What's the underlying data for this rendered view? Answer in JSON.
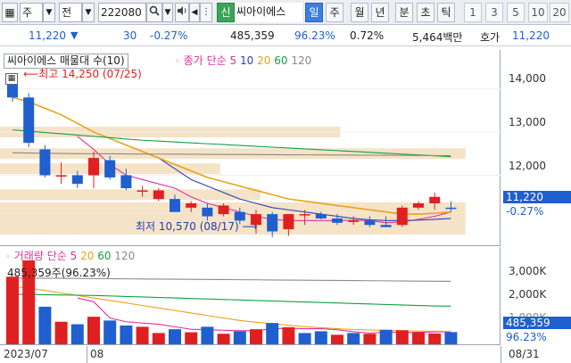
{
  "toolbar": {
    "type_value": "주",
    "range_value": "전",
    "code_value": "222080",
    "badge_label": "신",
    "stock_name": "씨아이에스",
    "period_tabs": [
      "일",
      "주",
      "월",
      "년",
      "분",
      "초",
      "틱"
    ],
    "active_tab_index": 0,
    "minute_options": [
      "1",
      "3",
      "5",
      "10",
      "20"
    ]
  },
  "quote": {
    "price": "11,220",
    "change": "30",
    "change_pct": "-0.27%",
    "volume": "485,359",
    "volume_ratio": "96.23%",
    "turnover": "0.72%",
    "amount": "5,464백만",
    "bid_label": "호가",
    "bid_price": "11,220"
  },
  "price_chart": {
    "legend_name": "씨아이에스 매물대 수(10)",
    "legend_ma_label": "종가 단순",
    "ma_periods": [
      "5",
      "10",
      "20",
      "60",
      "120"
    ],
    "ma_colors": [
      "#e0329a",
      "#2b3fb6",
      "#e8a21a",
      "#13a043",
      "#8a8a8a"
    ],
    "high_annotation": "최고 14,250 (07/25)",
    "low_annotation": "최저 10,570 (08/17)",
    "axis_labels": [
      "14,000",
      "13,000",
      "12,000"
    ],
    "current_price_tag": "11,220",
    "current_change_tag": "-0.27%"
  },
  "volume_chart": {
    "legend_name": "거래량",
    "legend_ma_label": "단순",
    "ma_periods": [
      "5",
      "20",
      "60",
      "120"
    ],
    "ma_colors": [
      "#e0329a",
      "#e8a21a",
      "#13a043",
      "#8a8a8a"
    ],
    "max_annotation": "485,359주(96.23%)",
    "axis_labels": [
      "3,000K",
      "2,000K",
      "1,000K"
    ],
    "current_volume_tag": "485,359",
    "current_ratio_tag": "96.23%"
  },
  "dates": {
    "start": "2023/07",
    "month_mark": "08",
    "end": "08/31"
  },
  "colors": {
    "up": "#e02020",
    "down": "#1f5fd0",
    "accent": "#3b7fe0",
    "volume_profile": "#f5e3c8"
  },
  "chart_data": [
    {
      "type": "candlestick",
      "title": "씨아이에스 매물대 수(10)",
      "ylim": [
        10400,
        14900
      ],
      "candles": [
        {
          "o": 14200,
          "h": 14250,
          "l": 13700,
          "c": 13800
        },
        {
          "o": 13800,
          "h": 13900,
          "l": 12650,
          "c": 12750
        },
        {
          "o": 12600,
          "h": 12700,
          "l": 11950,
          "c": 12000
        },
        {
          "o": 12000,
          "h": 12300,
          "l": 11800,
          "c": 12000
        },
        {
          "o": 12000,
          "h": 12100,
          "l": 11700,
          "c": 11800
        },
        {
          "o": 12000,
          "h": 12550,
          "l": 11700,
          "c": 12400
        },
        {
          "o": 12350,
          "h": 12450,
          "l": 11900,
          "c": 11950
        },
        {
          "o": 12000,
          "h": 12150,
          "l": 11650,
          "c": 11700
        },
        {
          "o": 11650,
          "h": 11750,
          "l": 11500,
          "c": 11650
        },
        {
          "o": 11450,
          "h": 11700,
          "l": 11400,
          "c": 11650
        },
        {
          "o": 11450,
          "h": 11550,
          "l": 11150,
          "c": 11150
        },
        {
          "o": 11250,
          "h": 11400,
          "l": 11150,
          "c": 11350
        },
        {
          "o": 11250,
          "h": 11350,
          "l": 10950,
          "c": 11050
        },
        {
          "o": 11100,
          "h": 11350,
          "l": 11050,
          "c": 11300
        },
        {
          "o": 11150,
          "h": 11250,
          "l": 10870,
          "c": 10950
        },
        {
          "o": 10850,
          "h": 11200,
          "l": 10650,
          "c": 11100
        },
        {
          "o": 11100,
          "h": 11150,
          "l": 10570,
          "c": 10700
        },
        {
          "o": 10750,
          "h": 11100,
          "l": 10600,
          "c": 11100
        },
        {
          "o": 11100,
          "h": 11200,
          "l": 10850,
          "c": 11100
        },
        {
          "o": 11100,
          "h": 11150,
          "l": 10980,
          "c": 11000
        },
        {
          "o": 11000,
          "h": 11100,
          "l": 10850,
          "c": 10900
        },
        {
          "o": 10950,
          "h": 11050,
          "l": 10850,
          "c": 10950
        },
        {
          "o": 10950,
          "h": 11050,
          "l": 10800,
          "c": 10850
        },
        {
          "o": 10850,
          "h": 11050,
          "l": 10800,
          "c": 10800
        },
        {
          "o": 10850,
          "h": 11300,
          "l": 10800,
          "c": 11250
        },
        {
          "o": 11250,
          "h": 11400,
          "l": 11200,
          "c": 11350
        },
        {
          "o": 11350,
          "h": 11600,
          "l": 11200,
          "c": 11500
        },
        {
          "o": 11250,
          "h": 11400,
          "l": 11150,
          "c": 11220
        }
      ],
      "ma": [
        {
          "period": "5",
          "values": [
            null,
            null,
            null,
            null,
            12900,
            12600,
            12250,
            12000,
            11900,
            11800,
            11700,
            11500,
            11350,
            11250,
            11150,
            11050,
            10980,
            10950,
            10950,
            10950,
            10950,
            10960,
            10950,
            10900,
            10920,
            10980,
            11050,
            11150
          ]
        },
        {
          "period": "10",
          "values": [
            null,
            null,
            null,
            null,
            null,
            null,
            null,
            null,
            null,
            12400,
            12150,
            11900,
            11750,
            11600,
            11450,
            11350,
            11250,
            11200,
            11150,
            11100,
            11050,
            11000,
            10970,
            10950,
            10950,
            10960,
            10980,
            11000
          ]
        },
        {
          "period": "20",
          "values": [
            13800,
            13700,
            13550,
            13400,
            13200,
            13000,
            12850,
            12700,
            12550,
            12400,
            12250,
            12100,
            11950,
            11850,
            11750,
            11650,
            11550,
            11450,
            11400,
            11350,
            11300,
            11250,
            11200,
            11150,
            11100,
            11100,
            11120,
            11150
          ]
        },
        {
          "period": "60",
          "values": [
            13050,
            13020,
            12990,
            12960,
            12930,
            12900,
            12870,
            12840,
            12810,
            12790,
            12770,
            12750,
            12730,
            12710,
            12690,
            12670,
            12650,
            12630,
            12610,
            12590,
            12570,
            12550,
            12530,
            12510,
            12490,
            12470,
            12450,
            12430
          ]
        },
        {
          "period": "120",
          "values": [
            12520,
            12515,
            12510,
            12505,
            12500,
            12498,
            12496,
            12494,
            12492,
            12490,
            12488,
            12486,
            12484,
            12482,
            12480,
            12478,
            12476,
            12474,
            12472,
            12470,
            12468,
            12466,
            12464,
            12462,
            12460,
            12458,
            12456,
            12454
          ]
        }
      ],
      "volume_profile": [
        {
          "price": 13000,
          "level": 0.68
        },
        {
          "price": 12500,
          "level": 0.93
        },
        {
          "price": 12150,
          "level": 0.44
        },
        {
          "price": 11550,
          "level": 0.52
        },
        {
          "price": 11250,
          "level": 0.93
        },
        {
          "price": 11000,
          "level": 0.93
        },
        {
          "price": 10750,
          "level": 0.93
        }
      ]
    },
    {
      "type": "bar",
      "title": "거래량",
      "ylim": [
        0,
        3600000
      ],
      "values": [
        2700000,
        3350000,
        1500000,
        900000,
        800000,
        1100000,
        950000,
        750000,
        700000,
        450000,
        600000,
        480000,
        700000,
        420000,
        520000,
        600000,
        850000,
        680000,
        450000,
        520000,
        380000,
        450000,
        420000,
        580000,
        560000,
        480000,
        430000,
        485359
      ],
      "up_days": [
        true,
        true,
        false,
        true,
        false,
        true,
        false,
        false,
        true,
        true,
        false,
        true,
        false,
        true,
        false,
        true,
        false,
        true,
        false,
        false,
        true,
        false,
        true,
        false,
        true,
        true,
        true,
        false
      ],
      "ma": [
        {
          "period": "5",
          "values": [
            null,
            null,
            null,
            null,
            1850000,
            1700000,
            1050000,
            900000,
            850000,
            800000,
            700000,
            600000,
            580000,
            560000,
            540000,
            540000,
            620000,
            640000,
            620000,
            620000,
            580000,
            500000,
            450000,
            480000,
            470000,
            480000,
            490000,
            500000
          ]
        },
        {
          "period": "20",
          "values": [
            2300000,
            2250000,
            2150000,
            2050000,
            1950000,
            1850000,
            1750000,
            1650000,
            1550000,
            1450000,
            1350000,
            1250000,
            1150000,
            1050000,
            950000,
            880000,
            820000,
            760000,
            700000,
            660000,
            620000,
            590000,
            570000,
            550000,
            540000,
            530000,
            520000,
            510000
          ]
        },
        {
          "period": "60",
          "values": [
            2000000,
            1990000,
            1980000,
            1970000,
            1960000,
            1950000,
            1930000,
            1910000,
            1890000,
            1870000,
            1850000,
            1830000,
            1810000,
            1790000,
            1770000,
            1750000,
            1730000,
            1710000,
            1690000,
            1670000,
            1650000,
            1630000,
            1610000,
            1590000,
            1570000,
            1550000,
            1530000,
            1520000
          ]
        },
        {
          "period": "120",
          "values": [
            2650000,
            2645000,
            2640000,
            2635000,
            2630000,
            2625000,
            2620000,
            2615000,
            2610000,
            2605000,
            2600000,
            2595000,
            2590000,
            2585000,
            2580000,
            2575000,
            2570000,
            2565000,
            2560000,
            2555000,
            2550000,
            2545000,
            2540000,
            2535000,
            2530000,
            2525000,
            2520000,
            2515000
          ]
        }
      ]
    }
  ]
}
